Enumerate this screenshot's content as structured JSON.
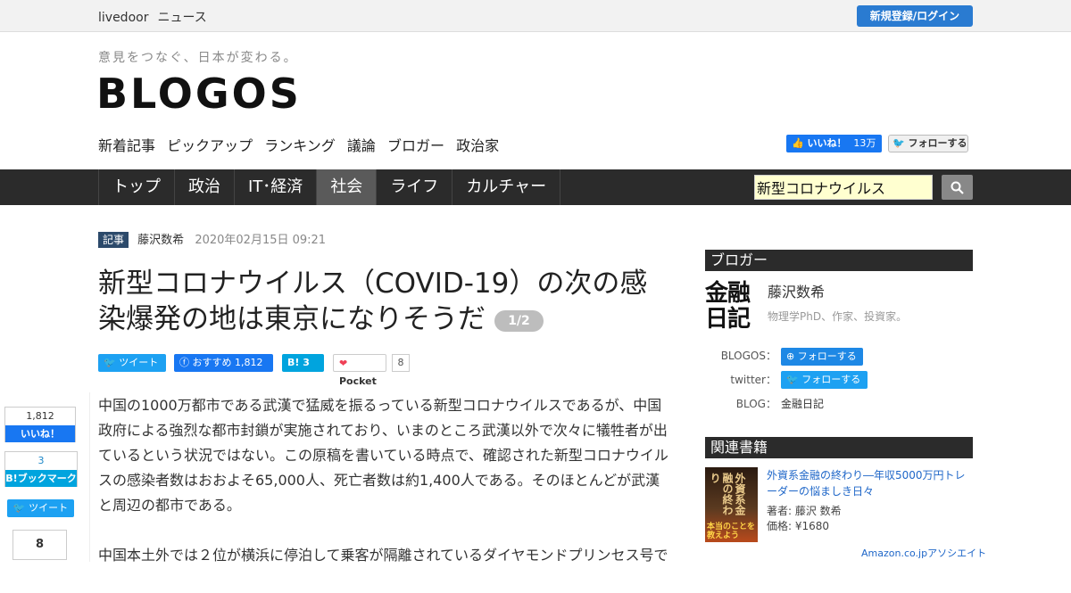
{
  "topbar": {
    "brand_1": "livedoor",
    "brand_2": "ニュース",
    "login": "新規登録/ログイン"
  },
  "header": {
    "tagline": "意見をつなぐ、日本が変わる。",
    "logo": "BLOGOS",
    "subnav": [
      "新着記事",
      "ピックアップ",
      "ランキング",
      "議論",
      "ブロガー",
      "政治家"
    ],
    "fb_like_label": "いいね！",
    "fb_like_count": "13万",
    "tw_follow_label": "フォローする"
  },
  "nav": {
    "tabs": [
      "トップ",
      "政治",
      "IT･経済",
      "社会",
      "ライフ",
      "カルチャー"
    ],
    "active_tab": "社会",
    "search_value": "新型コロナウイルス"
  },
  "article": {
    "category": "記事",
    "author": "藤沢数希",
    "date": "2020年02月15日 09:21",
    "title": "新型コロナウイルス（COVID-19）の次の感染爆発の地は東京になりそうだ",
    "page_badge": "1/2",
    "share": {
      "tweet": "ツイート",
      "fb_label": "おすすめ",
      "fb_count": "1,812",
      "hatena_count": "3",
      "pocket_label": "Pocket",
      "pocket_count": "8"
    },
    "paragraphs": [
      "中国の1000万都市である武漢で猛威を振るっている新型コロナウイルスであるが、中国政府による強烈な都市封鎖が実施されており、いまのところ武漢以外で次々に犠牲者が出ているという状況ではない。この原稿を書いている時点で、確認された新型コロナウイルスの感染者数はおおよそ65,000人、死亡者数は約1,400人である。そのほとんどが武漢と周辺の都市である。",
      "中国本土外では２位が横浜に停泊して乗客が隔離されているダイヤモンドプリンセス号で"
    ]
  },
  "side_share": {
    "fb_count": "1,812",
    "fb_label": "いいね！",
    "hatena_count": "3",
    "hatena_label": "B!ブックマーク",
    "tweet": "ツイート",
    "pocket_count": "8"
  },
  "sidebar": {
    "blogger_heading": "ブロガー",
    "blogger_logo": "金融日記",
    "blogger_name": "藤沢数希",
    "blogger_desc": "物理学PhD、作家、投資家。",
    "blogos_label": "BLOGOS：",
    "blogos_follow": "フォローする",
    "twitter_label": "twitter：",
    "twitter_follow": "フォローする",
    "blog_label": "BLOG：",
    "blog_name": "金融日記",
    "books_heading": "関連書籍",
    "book_title": "外資系金融の終わり―年収5000万円トレーダーの悩ましき日々",
    "book_cover_title": "外資系金融の終わり",
    "book_cover_obi": "本当のことを教えよう",
    "book_author": "著者: 藤沢 数希",
    "book_price": "価格: ¥1680",
    "amazon": "Amazon.co.jpアソシエイト"
  },
  "colors": {
    "nav_bg": "#2b2b2b",
    "login_blue": "#2a7bd1",
    "facebook": "#1877f2",
    "twitter": "#1da1f2",
    "hatena": "#00a4de"
  }
}
